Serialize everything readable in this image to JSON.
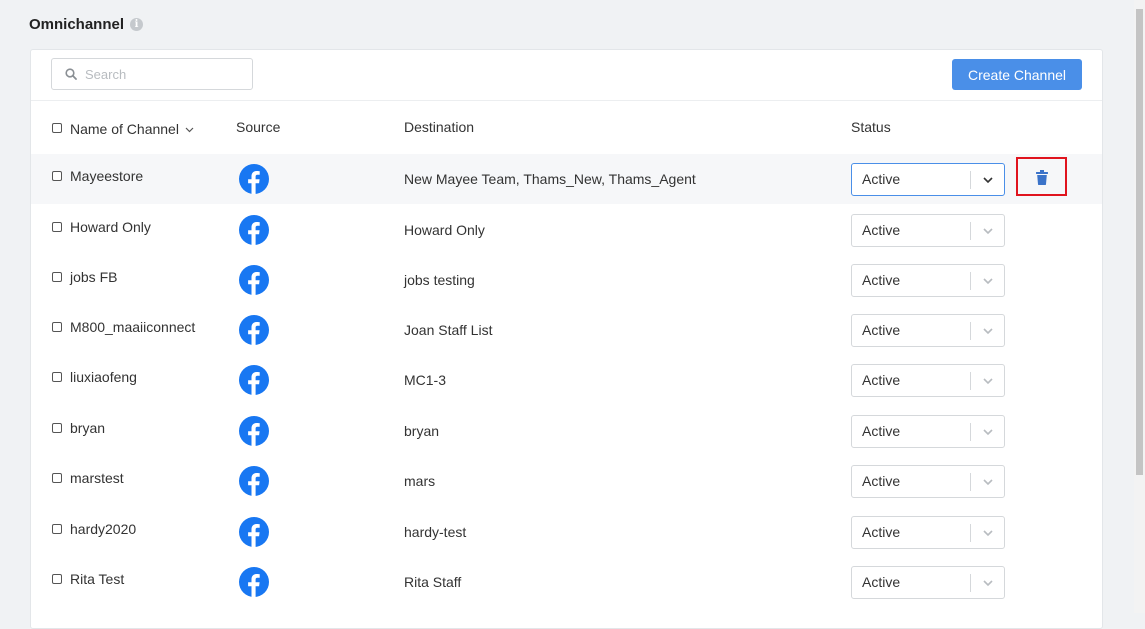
{
  "page": {
    "title": "Omnichannel",
    "info_glyph": "i"
  },
  "toolbar": {
    "search_placeholder": "Search",
    "create_label": "Create Channel"
  },
  "table": {
    "columns": {
      "name": "Name of Channel",
      "source": "Source",
      "destination": "Destination",
      "status": "Status"
    },
    "rows": [
      {
        "name": "Mayeestore",
        "source": "facebook",
        "destination": "New Mayee Team, Thams_New, Thams_Agent",
        "status": "Active"
      },
      {
        "name": "Howard Only",
        "source": "facebook",
        "destination": "Howard Only",
        "status": "Active"
      },
      {
        "name": "jobs FB",
        "source": "facebook",
        "destination": "jobs testing",
        "status": "Active"
      },
      {
        "name": "M800_maaiiconnect",
        "source": "facebook",
        "destination": "Joan Staff List",
        "status": "Active"
      },
      {
        "name": "liuxiaofeng",
        "source": "facebook",
        "destination": "MC1-3",
        "status": "Active"
      },
      {
        "name": "bryan",
        "source": "facebook",
        "destination": "bryan",
        "status": "Active"
      },
      {
        "name": "marstest",
        "source": "facebook",
        "destination": "mars",
        "status": "Active"
      },
      {
        "name": "hardy2020",
        "source": "facebook",
        "destination": "hardy-test",
        "status": "Active"
      },
      {
        "name": "Rita Test",
        "source": "facebook",
        "destination": "Rita Staff",
        "status": "Active"
      }
    ]
  },
  "colors": {
    "accent": "#4a8fe8",
    "facebook": "#1877f2",
    "highlight": "#e0141e"
  }
}
